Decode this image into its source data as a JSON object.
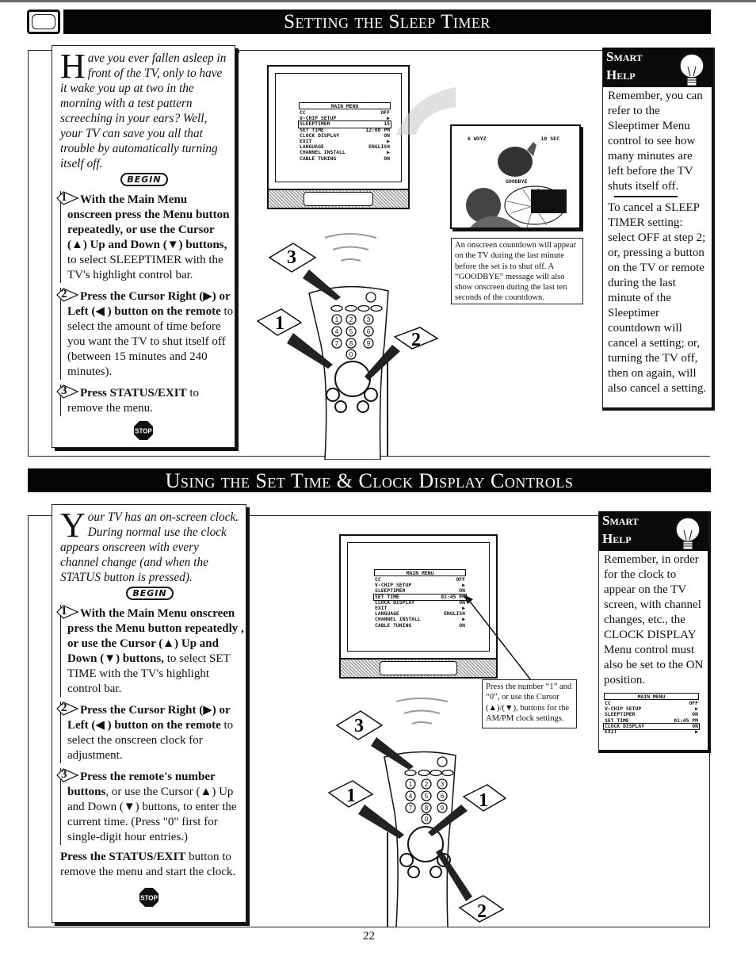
{
  "page": {
    "number": "22"
  },
  "section1": {
    "title": "Setting the Sleep Timer",
    "intro": {
      "dropcap": "H",
      "text": "ave you ever fallen asleep in front of the TV, only to have it wake you up at two in the morning with a test pattern screeching in your ears? Well, your TV can save you all that trouble by automatically turning itself off."
    },
    "begin_label": "BEGIN",
    "steps": [
      {
        "num": "1",
        "bold": "With the Main Menu onscreen press the Menu button repeatedly, or use the Cursor (▲) Up and Down (▼) buttons,",
        "text": " to select SLEEPTIMER with the TV's highlight control bar."
      },
      {
        "num": "2",
        "bold": "Press the Cursor Right (▶) or Left (◀ ) button on the remote",
        "text": " to select the amount of time before you want the TV to shut itself off (between 15 minutes and 240 minutes)."
      },
      {
        "num": "3",
        "bold": "Press STATUS/EXIT",
        "text": " to remove the menu."
      }
    ],
    "stop_label": "STOP",
    "tv_menu": {
      "title": "MAIN MENU",
      "rows": [
        {
          "label": "CC",
          "value": "OFF",
          "highlight": false
        },
        {
          "label": "V-CHIP SETUP",
          "value": "▶",
          "highlight": false
        },
        {
          "label": "SLEEPTIMER",
          "value": "15",
          "highlight": true
        },
        {
          "label": "SET TIME",
          "value": "12:00 PM",
          "highlight": false
        },
        {
          "label": "CLOCK DISPLAY",
          "value": "ON",
          "highlight": false
        },
        {
          "label": "EXIT",
          "value": "▶",
          "highlight": false
        },
        {
          "label": "LANGUAGE",
          "value": "ENGLISH",
          "highlight": false
        },
        {
          "label": "CHANNEL INSTALL",
          "value": "▶",
          "highlight": false
        },
        {
          "label": "CABLE TUNING",
          "value": "ON",
          "highlight": false
        }
      ]
    },
    "screen_pic": {
      "channel": "6 WXYZ",
      "countdown": "10 SEC",
      "message": "GOODBYE"
    },
    "caption": "An onscreen countdown will appear on the TV during the last minute before the set is to shut off. A “GOODBYE” message will also show onscreen during the last ten seconds of the countdown.",
    "remote_markers": [
      "3",
      "1",
      "2"
    ],
    "smart_help": {
      "title_line1": "Smart",
      "title_line2": "Help",
      "para1": "Remember, you can refer to the Sleeptimer Menu control to see how many minutes are left before the TV shuts itself off.",
      "para2": "To cancel a SLEEP TIMER setting: select OFF at step 2; or, pressing a button on the TV or remote during the last minute of the Sleeptimer countdown will cancel a setting; or, turning the TV off, then on again, will also cancel a setting."
    }
  },
  "section2": {
    "title": "Using the Set Time  & Clock Display Controls",
    "intro": {
      "dropcap": "Y",
      "text": "our TV has an on-screen clock. During normal use the clock appears onscreen with every channel change (and when the STATUS button is pressed)."
    },
    "begin_label": "BEGIN",
    "steps": [
      {
        "num": "1",
        "bold": "With the Main Menu onscreen press the Menu button repeatedly , or use the Cursor (▲) Up and Down (▼) buttons,",
        "text": " to select SET TIME with the TV's highlight control bar."
      },
      {
        "num": "2",
        "bold": "Press the Cursor Right (▶) or Left (◀ ) button on the remote",
        "text": " to select the onscreen clock for adjustment."
      },
      {
        "num": "3",
        "bold": "Press the remote's number buttons",
        "text": ", or use the Cursor (▲) Up and Down (▼) buttons, to enter the current time. (Press \"0\" first for single-digit hour entries.)"
      }
    ],
    "final": {
      "bold": "Press the STATUS/EXIT",
      "text": " button to remove the menu and start the clock."
    },
    "stop_label": "STOP",
    "tv_menu": {
      "title": "MAIN MENU",
      "rows": [
        {
          "label": "CC",
          "value": "OFF",
          "highlight": false
        },
        {
          "label": "V-CHIP SETUP",
          "value": "▶",
          "highlight": false
        },
        {
          "label": "SLEEPTIMER",
          "value": "ON",
          "highlight": false
        },
        {
          "label": "SET TIME",
          "value": "01:45 PM",
          "highlight": true
        },
        {
          "label": "CLOCK DISPLAY",
          "value": "ON",
          "highlight": false
        },
        {
          "label": "EXIT",
          "value": "▶",
          "highlight": false
        },
        {
          "label": "LANGUAGE",
          "value": "ENGLISH",
          "highlight": false
        },
        {
          "label": "CHANNEL INSTALL",
          "value": "▶",
          "highlight": false
        },
        {
          "label": "CABLE TUNING",
          "value": "ON",
          "highlight": false
        }
      ]
    },
    "caption": "Press the number “1” and “0”, or use the Cursor (▲)/(▼), buttons for the AM/PM clock settings.",
    "remote_markers": [
      "3",
      "1",
      "1",
      "2"
    ],
    "smart_help": {
      "title_line1": "Smart",
      "title_line2": "Help",
      "para1": "Remember, in order for the clock to appear on the TV screen, with channel changes, etc., the CLOCK DISPLAY Menu control must also be set to the ON position.",
      "mini_menu": {
        "title": "MAIN MENU",
        "rows": [
          {
            "label": "CC",
            "value": "OFF",
            "highlight": false
          },
          {
            "label": "V-CHIP SETUP",
            "value": "▶",
            "highlight": false
          },
          {
            "label": "SLEEPTIMER",
            "value": "ON",
            "highlight": false
          },
          {
            "label": "SET TIME",
            "value": "01:45 PM",
            "highlight": false
          },
          {
            "label": "CLOCK DISPLAY",
            "value": "ON",
            "highlight": true
          },
          {
            "label": "EXIT",
            "value": "▶",
            "highlight": false
          }
        ]
      }
    }
  }
}
